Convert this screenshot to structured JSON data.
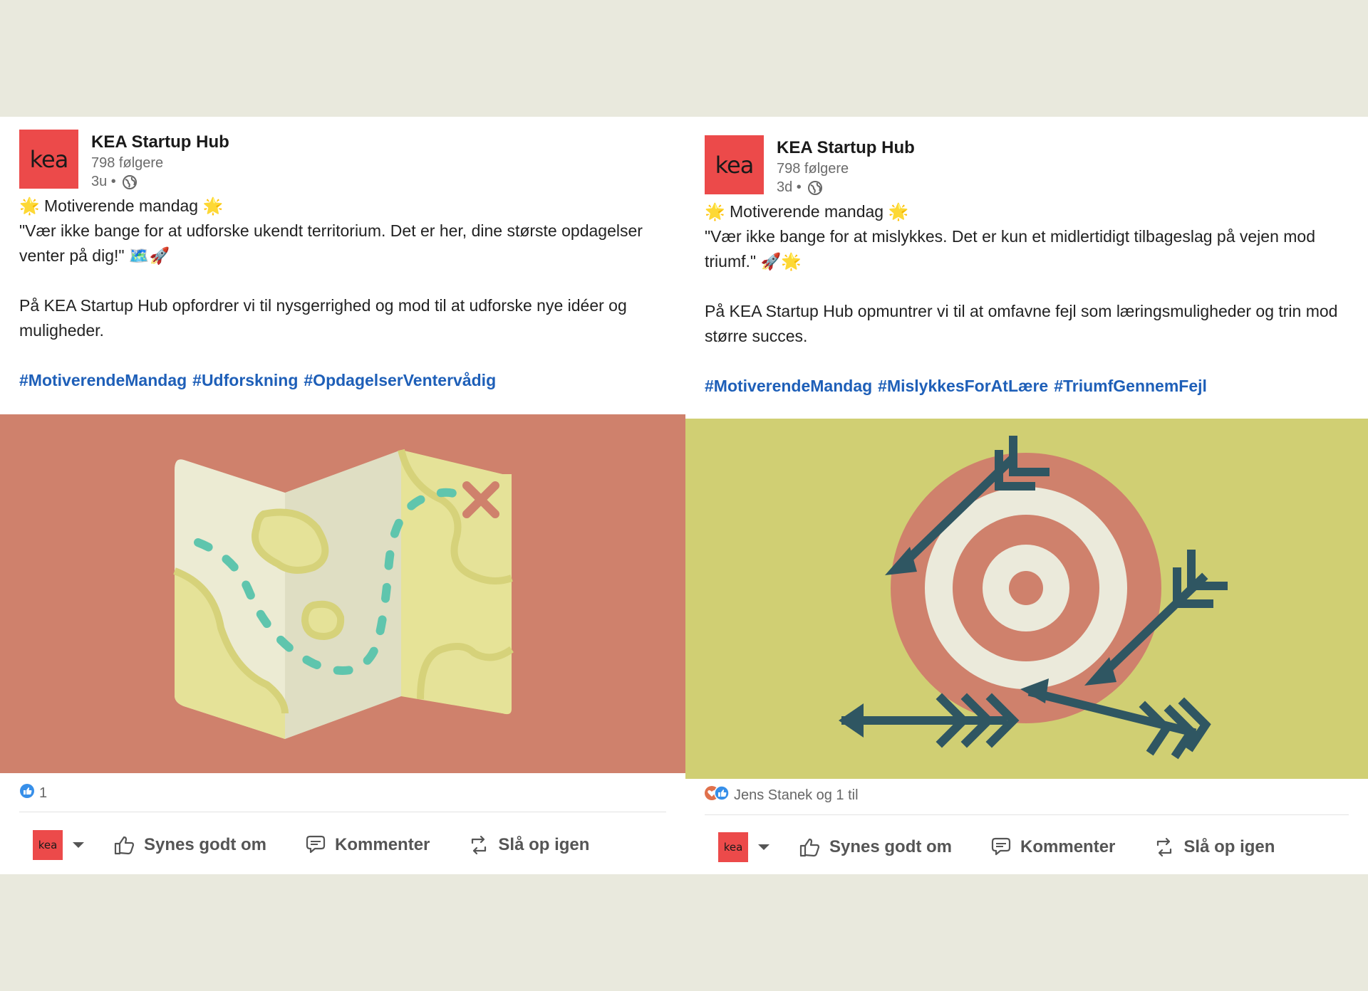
{
  "posts": [
    {
      "author": "KEA Startup Hub",
      "logo_text": "kea",
      "followers": "798 følgere",
      "time": "3u •",
      "line1": "🌟 Motiverende mandag 🌟",
      "line2": "\"Vær ikke bange for at udforske ukendt territorium. Det er her, dine største opdagelser venter på dig!\" 🗺️🚀",
      "line3": "På KEA Startup Hub opfordrer vi til nysgerrighed og mod til at udforske nye idéer og muligheder.",
      "hashtags": [
        "#MotiverendeMandag",
        "#Udforskning",
        "#OpdagelserVentervådig"
      ],
      "reaction_text": "1",
      "image_bg": "#cf816c"
    },
    {
      "author": "KEA Startup Hub",
      "logo_text": "kea",
      "followers": "798 følgere",
      "time": "3d •",
      "line1": "🌟 Motiverende mandag 🌟",
      "line2": "\"Vær ikke bange for at mislykkes. Det er kun et midlertidigt tilbageslag på vejen mod triumf.\" 🚀🌟",
      "line3": "På KEA Startup Hub opmuntrer vi til at omfavne fejl som læringsmuligheder og trin mod større succes.",
      "hashtags": [
        "#MotiverendeMandag",
        "#MislykkesForAtLære",
        "#TriumfGennemFejl"
      ],
      "reaction_text": "Jens Stanek og 1 til",
      "image_bg": "#d0cf73"
    }
  ],
  "actions": {
    "like": "Synes godt om",
    "comment": "Kommenter",
    "repost": "Slå op igen"
  },
  "colors": {
    "brand": "#ec4a4a",
    "hashtag": "#1e5fb8",
    "background": "#e9e9dd"
  }
}
